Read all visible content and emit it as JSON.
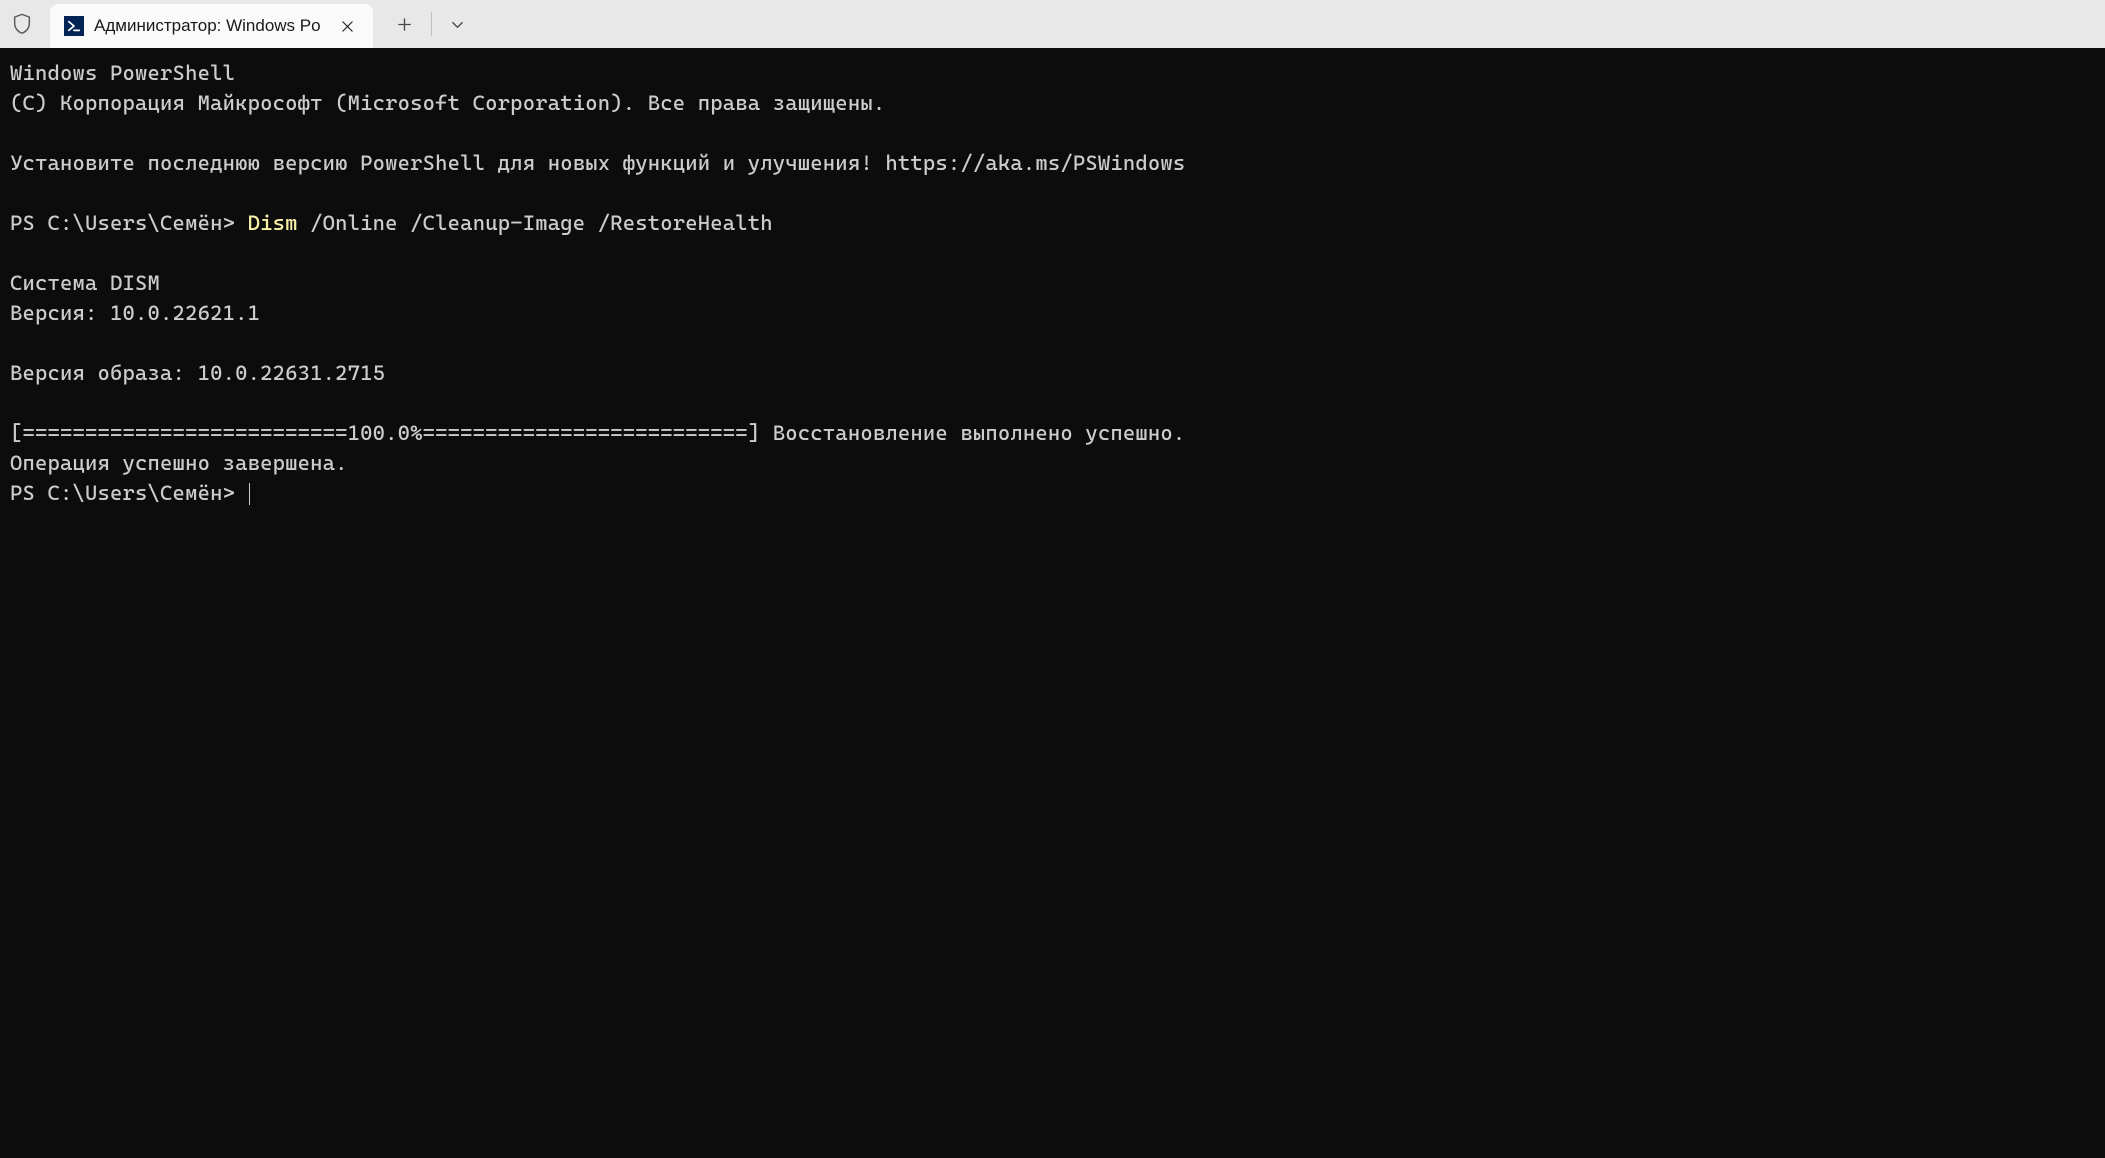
{
  "tab": {
    "title": "Администратор: Windows Po"
  },
  "terminal": {
    "banner_line1": "Windows PowerShell",
    "banner_line2": "(C) Корпорация Майкрософт (Microsoft Corporation). Все права защищены.",
    "banner_line3": "Установите последнюю версию PowerShell для новых функций и улучшения! https://aka.ms/PSWindows",
    "prompt1": "PS C:\\Users\\Семён> ",
    "cmd_tool": "Dism",
    "cmd_args": " /Online /Cleanup-Image /RestoreHealth",
    "output_line1": "Cистема DISM",
    "output_line2": "Версия: 10.0.22621.1",
    "output_line3": "Версия образа: 10.0.22631.2715",
    "progress": "[==========================100.0%==========================] Восстановление выполнено успешно.",
    "done": "Операция успешно завершена.",
    "prompt2": "PS C:\\Users\\Семён> "
  }
}
